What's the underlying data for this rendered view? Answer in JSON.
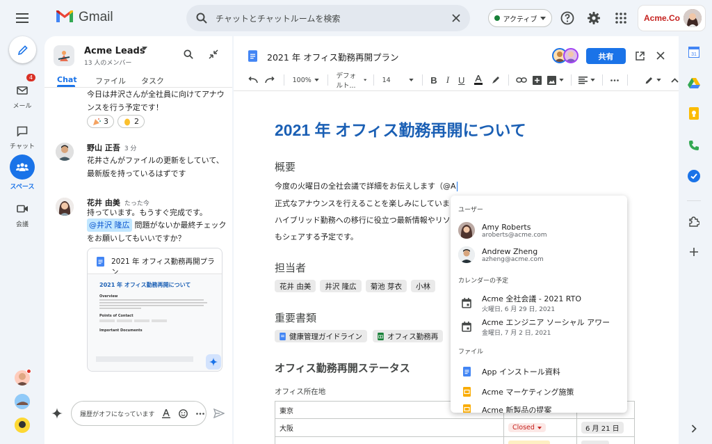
{
  "app": {
    "name": "Gmail"
  },
  "search": {
    "placeholder": "チャットとチャットルームを検索"
  },
  "status": {
    "label": "アクティブ"
  },
  "brand": {
    "label": "Acme.Co"
  },
  "nav": {
    "mail_label": "メール",
    "mail_badge": "4",
    "chat_label": "チャット",
    "spaces_label": "スペース",
    "meet_label": "会議"
  },
  "space": {
    "name": "Acme Leads",
    "members": "13 人のメンバー",
    "tabs": [
      "Chat",
      "ファイル",
      "タスク"
    ]
  },
  "messages": {
    "m0_text": "今日は井沢さんが全社員に向けてアナウンスを行う予定です！",
    "reaction1_count": "3",
    "reaction2_count": "2",
    "m1_name": "野山 正吾",
    "m1_time": "3 分",
    "m1_text": "花井さんがファイルの更新をしていて、最新版を持っているはずです",
    "m2_name": "花井 由美",
    "m2_time": "たった今",
    "m2_line1": "持っています。もうすぐ完成です。",
    "m2_mention": "@井沢 隆広",
    "m2_line2": "問題がないか最終チェック",
    "m2_line3": "をお願いしてもいいですか？",
    "card_title": "2021 年 オフィス勤務再開プラン",
    "card_preview_title": "2021 年 オフィス勤務再開について",
    "card_preview_overview": "Overview",
    "card_preview_contact": "Points of Contact",
    "card_preview_docs": "Important Documents"
  },
  "composer": {
    "placeholder": "履歴がオフになっています"
  },
  "doc": {
    "title": "2021 年 オフィス勤務再開プラン",
    "share_label": "共有",
    "zoom": "100%",
    "font": "デフォルト...",
    "font_size": "14",
    "heading": "2021 年 オフィス勤務再開について",
    "overview_title": "概要",
    "overview_l1": "今度の火曜日の全社会議で詳細をお伝えします（@A",
    "overview_l2": "正式なアナウンスを行えることを楽しみにしていま",
    "overview_l3": "ハイブリッド勤務への移行に役立つ最新情報やリソ",
    "overview_l4": "もシェアする予定です。",
    "contacts_title": "担当者",
    "contacts": [
      "花井 由美",
      "井沢 隆広",
      "菊池 芽衣",
      "小林"
    ],
    "docs_title": "重要書類",
    "doc1": "健康管理ガイドライン",
    "doc2": "オフィス勤務再",
    "status_title": "オフィス勤務再開ステータス",
    "location_label": "オフィス所在地",
    "table": {
      "r1": "東京",
      "r2": "大阪",
      "r2_status": "Closed",
      "r2_date": "6 月 21 日"
    }
  },
  "popup": {
    "users_label": "ユーザー",
    "u1_name": "Amy Roberts",
    "u1_email": "aroberts@acme.com",
    "u2_name": "Andrew Zheng",
    "u2_email": "azheng@acme.com",
    "calendar_label": "カレンダーの予定",
    "e1_title": "Acme 全社会議 - 2021 RTO",
    "e1_date": "火曜日, 6 月 29 日, 2021",
    "e2_title": "Acme エンジニア ソーシャル アワー",
    "e2_date": "金曜日, 7 月 2 日, 2021",
    "files_label": "ファイル",
    "f1": "App インストール資料",
    "f2": "Acme マーケティング施策",
    "f3": "Acme 新製品の提案"
  },
  "colors": {
    "accent": "#1a73e8",
    "doc_heading": "#1a5fb4",
    "gmail_red": "#ea4335",
    "closed_red": "#c5221f"
  }
}
